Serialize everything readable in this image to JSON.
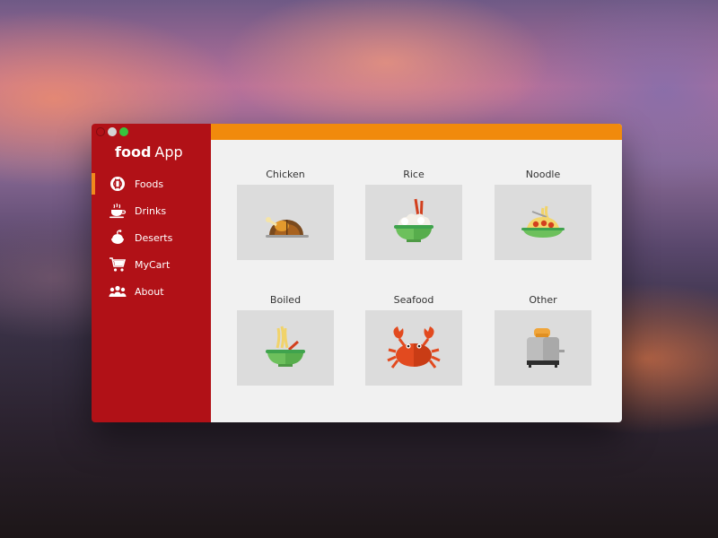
{
  "app": {
    "brand_bold": "food",
    "brand_regular": "App"
  },
  "sidebar": {
    "items": [
      {
        "label": "Foods",
        "icon": "plate-cutlery-icon",
        "active": true
      },
      {
        "label": "Drinks",
        "icon": "coffee-cup-icon",
        "active": false
      },
      {
        "label": "Deserts",
        "icon": "dessert-icon",
        "active": false
      },
      {
        "label": "MyCart",
        "icon": "cart-icon",
        "active": false
      },
      {
        "label": "About",
        "icon": "people-icon",
        "active": false
      }
    ]
  },
  "categories": [
    {
      "label": "Chicken",
      "icon": "roast-chicken-icon"
    },
    {
      "label": "Rice",
      "icon": "rice-bowl-icon"
    },
    {
      "label": "Noodle",
      "icon": "noodle-plate-icon"
    },
    {
      "label": "Boiled",
      "icon": "boiled-bowl-icon"
    },
    {
      "label": "Seafood",
      "icon": "crab-icon"
    },
    {
      "label": "Other",
      "icon": "toaster-icon"
    }
  ],
  "colors": {
    "sidebar": "#b11117",
    "accent": "#f18a0c",
    "content_bg": "#f1f1f1",
    "tile_bg": "#dcdcdc"
  }
}
